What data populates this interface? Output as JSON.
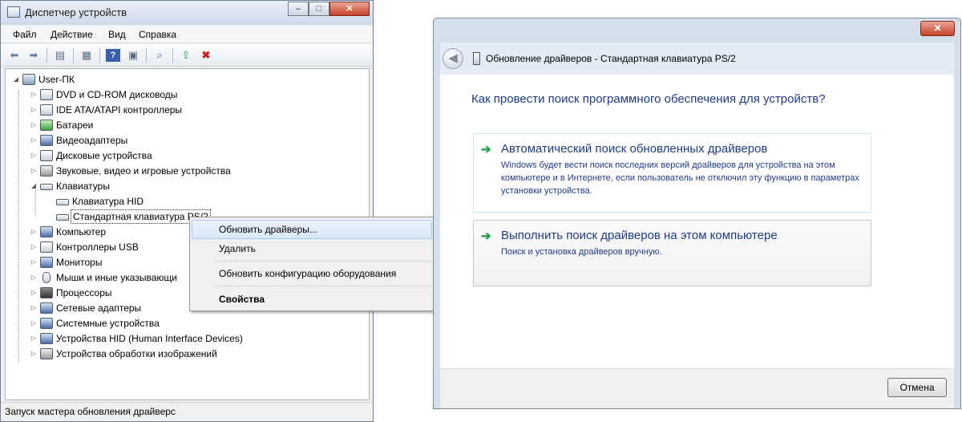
{
  "device_manager": {
    "title": "Диспетчер устройств",
    "caption_buttons": {
      "minimize": "‒",
      "maximize": "□",
      "close": "✕"
    },
    "menu": [
      "Файл",
      "Действие",
      "Вид",
      "Справка"
    ],
    "toolbar_icons": [
      "back-arrow-icon",
      "forward-arrow-icon",
      "console-tree-icon",
      "properties-icon",
      "help-icon",
      "view-icon",
      "scan-hardware-icon",
      "update-driver-icon",
      "uninstall-icon"
    ],
    "root": "User-ПК",
    "tree": [
      {
        "label": "DVD и CD-ROM дисководы",
        "icon": "dvd-drive-icon",
        "expanded": false
      },
      {
        "label": "IDE ATA/ATAPI контроллеры",
        "icon": "ide-controller-icon",
        "expanded": false
      },
      {
        "label": "Батареи",
        "icon": "battery-icon",
        "expanded": false
      },
      {
        "label": "Видеоадаптеры",
        "icon": "display-adapter-icon",
        "expanded": false
      },
      {
        "label": "Дисковые устройства",
        "icon": "disk-drive-icon",
        "expanded": false
      },
      {
        "label": "Звуковые, видео и игровые устройства",
        "icon": "sound-icon",
        "expanded": false
      },
      {
        "label": "Клавиатуры",
        "icon": "keyboard-icon",
        "expanded": true
      },
      {
        "label": "Клавиатура HID",
        "icon": "keyboard-icon",
        "child": true
      },
      {
        "label": "Стандартная клавиатура PS/2",
        "icon": "keyboard-icon",
        "child": true,
        "selected": true
      },
      {
        "label": "Компьютер",
        "icon": "computer-icon",
        "expanded": false
      },
      {
        "label": "Контроллеры USB",
        "icon": "usb-icon",
        "expanded": false
      },
      {
        "label": "Мониторы",
        "icon": "monitor-icon",
        "expanded": false
      },
      {
        "label": "Мыши и иные указывающи",
        "icon": "mouse-icon",
        "expanded": false
      },
      {
        "label": "Процессоры",
        "icon": "processor-icon",
        "expanded": false
      },
      {
        "label": "Сетевые адаптеры",
        "icon": "network-adapter-icon",
        "expanded": false
      },
      {
        "label": "Системные устройства",
        "icon": "system-device-icon",
        "expanded": false
      },
      {
        "label": "Устройства HID (Human Interface Devices)",
        "icon": "hid-icon",
        "expanded": false
      },
      {
        "label": "Устройства обработки изображений",
        "icon": "imaging-device-icon",
        "expanded": false
      }
    ],
    "status": "Запуск мастера обновления драйверс"
  },
  "context_menu": {
    "items": [
      {
        "label": "Обновить драйверы...",
        "highlighted": true
      },
      {
        "label": "Удалить"
      },
      {
        "label": "Обновить конфигурацию оборудования"
      },
      {
        "label": "Свойства",
        "bold": true
      }
    ]
  },
  "update_dialog": {
    "close_label": "✕",
    "title": "Обновление драйверов - Стандартная клавиатура PS/2",
    "question": "Как провести поиск программного обеспечения для устройств?",
    "options": [
      {
        "title": "Автоматический поиск обновленных драйверов",
        "description": "Windows будет вести поиск последних версий драйверов для устройства на этом компьютере и в Интернете, если пользователь не отключил эту функцию в параметрах установки устройства."
      },
      {
        "title": "Выполнить поиск драйверов на этом компьютере",
        "description": "Поиск и установка драйверов вручную."
      }
    ],
    "cancel_label": "Отмена",
    "accent_color": "#1e3a8a",
    "arrow_color": "#1fa347"
  }
}
